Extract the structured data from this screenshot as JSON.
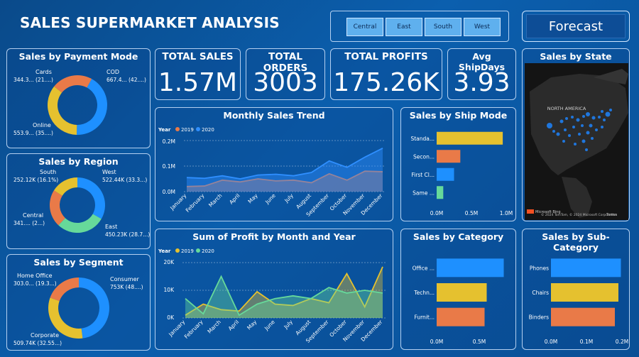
{
  "title": "SALES SUPERMARKET ANALYSIS",
  "regions": [
    "Central",
    "East",
    "South",
    "West"
  ],
  "forecast_label": "Forecast",
  "kpis": [
    {
      "label": "TOTAL SALES",
      "value": "1.57M"
    },
    {
      "label": "TOTAL ORDERS",
      "value": "3003"
    },
    {
      "label": "TOTAL PROFITS",
      "value": "175.26K"
    },
    {
      "label": "Avg ShipDays",
      "value": "3.93"
    }
  ],
  "payment": {
    "title": "Sales by Payment Mode",
    "slices": [
      {
        "name": "COD",
        "line2": "667.4... (42....)",
        "value": 42,
        "color": "#1e90ff"
      },
      {
        "name": "Online",
        "line2": "553.9... (35....)",
        "value": 35,
        "color": "#e5c12f"
      },
      {
        "name": "Cards",
        "line2": "344.3... (21....)",
        "value": 22,
        "color": "#e97a48"
      }
    ]
  },
  "region": {
    "title": "Sales by Region",
    "slices": [
      {
        "name": "West",
        "line2": "522.44K (33.3...)",
        "value": 33.3,
        "color": "#1e90ff"
      },
      {
        "name": "East",
        "line2": "450.23K (28.7...)",
        "value": 28.7,
        "color": "#66d99a"
      },
      {
        "name": "Central",
        "line2": "341.... (2...)",
        "value": 21.9,
        "color": "#e97a48"
      },
      {
        "name": "South",
        "line2": "252.12K (16.1%)",
        "value": 16.1,
        "color": "#e5c12f"
      }
    ]
  },
  "segment": {
    "title": "Sales by Segment",
    "slices": [
      {
        "name": "Consumer",
        "line2": "753K (48....)",
        "value": 48,
        "color": "#1e90ff"
      },
      {
        "name": "Corporate",
        "line2": "509.74K (32.55...)",
        "value": 32.5,
        "color": "#e5c12f"
      },
      {
        "name": "Home Office",
        "line2": "303.0... (19.3...)",
        "value": 19.5,
        "color": "#e97a48"
      }
    ]
  },
  "monthly": {
    "title": "Monthly Sales Trend",
    "legend_title": "Year",
    "months": [
      "January",
      "February",
      "March",
      "April",
      "May",
      "June",
      "July",
      "August",
      "September",
      "October",
      "November",
      "December"
    ],
    "yticks": [
      "0.0M",
      "0.1M",
      "0.2M"
    ]
  },
  "profit": {
    "title": "Sum of Profit by Month and Year",
    "legend_title": "Year",
    "yticks": [
      "0K",
      "10K",
      "20K"
    ]
  },
  "shipmode": {
    "title": "Sales by Ship Mode",
    "xticks": [
      "0.0M",
      "0.5M",
      "1.0M"
    ]
  },
  "state": {
    "title": "Sales by State",
    "map_label": "NORTH AMERICA",
    "attribution": "© 2024 TomTom, © 2024 Microsoft Corporation",
    "terms": "Terms",
    "logo": "Microsoft Bing"
  },
  "category": {
    "title": "Sales by Category",
    "xticks": [
      "0.0M",
      "0.5M"
    ]
  },
  "subcategory": {
    "title": "Sales by Sub-Category",
    "xticks": [
      "0.0M",
      "0.1M",
      "0.2M"
    ]
  },
  "chart_data": [
    {
      "type": "area",
      "title": "Monthly Sales Trend",
      "categories": [
        "January",
        "February",
        "March",
        "April",
        "May",
        "June",
        "July",
        "August",
        "September",
        "October",
        "November",
        "December"
      ],
      "series": [
        {
          "name": "2019",
          "color": "#e97a48",
          "values": [
            20000,
            22000,
            45000,
            38000,
            50000,
            42000,
            45000,
            35000,
            70000,
            45000,
            80000,
            78000
          ]
        },
        {
          "name": "2020",
          "color": "#2f8fff",
          "values": [
            55000,
            52000,
            62000,
            50000,
            65000,
            68000,
            62000,
            75000,
            120000,
            95000,
            135000,
            170000
          ]
        }
      ],
      "ylim": [
        0,
        200000
      ]
    },
    {
      "type": "area",
      "title": "Sum of Profit by Month and Year",
      "categories": [
        "January",
        "February",
        "March",
        "April",
        "May",
        "June",
        "July",
        "August",
        "September",
        "October",
        "November",
        "December"
      ],
      "series": [
        {
          "name": "2019",
          "color": "#e5c12f",
          "values": [
            1000,
            5000,
            3000,
            2500,
            9500,
            5000,
            4500,
            7000,
            5500,
            16000,
            4000,
            18500
          ]
        },
        {
          "name": "2020",
          "color": "#66d99a",
          "values": [
            7000,
            1500,
            15000,
            1000,
            5000,
            7000,
            8000,
            7000,
            11000,
            9000,
            10000,
            9000
          ]
        }
      ],
      "ylim": [
        0,
        20000
      ]
    },
    {
      "type": "bar",
      "title": "Sales by Ship Mode",
      "categories": [
        "Standa...",
        "Secon...",
        "First Cl...",
        "Same ..."
      ],
      "values": [
        950000,
        340000,
        250000,
        95000
      ],
      "colors": [
        "#e5c12f",
        "#e97a48",
        "#1e90ff",
        "#66d99a"
      ],
      "xlim": [
        0,
        1000000
      ]
    },
    {
      "type": "bar",
      "title": "Sales by Category",
      "categories": [
        "Office ...",
        "Techn...",
        "Furnit..."
      ],
      "values": [
        630000,
        470000,
        450000
      ],
      "colors": [
        "#1e90ff",
        "#e5c12f",
        "#e97a48"
      ],
      "xlim": [
        0,
        800000
      ]
    },
    {
      "type": "bar",
      "title": "Sales by Sub-Category",
      "categories": [
        "Phones",
        "Chairs",
        "Binders"
      ],
      "values": [
        197000,
        190000,
        180000
      ],
      "colors": [
        "#1e90ff",
        "#e5c12f",
        "#e97a48"
      ],
      "xlim": [
        0,
        200000
      ]
    }
  ]
}
